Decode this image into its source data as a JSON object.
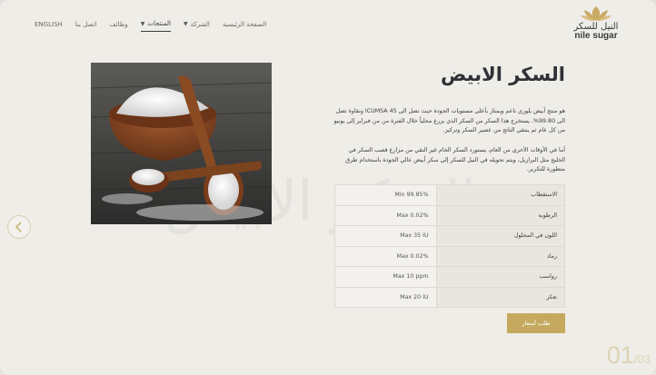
{
  "header": {
    "logo": {
      "arabic": "النيل للسكر",
      "english": "nile sugar"
    },
    "nav": [
      {
        "label": "ENGLISH"
      },
      {
        "label": "اتصل بنا"
      },
      {
        "label": "وظائف"
      },
      {
        "label": "المنتجات"
      },
      {
        "label": "الشركة"
      },
      {
        "label": "الصفحة الرئيسية"
      }
    ]
  },
  "watermark": "السكر الابيض",
  "product": {
    "title": "السكر الابيض",
    "paragraph_1": "هو منتج أبيض بلوري ناعم ويمتاز بأعلى مستويات الجودة حيث تصل الى ICUMSA 45 ونقاوة تصل الى 99.80%. يستخرج هذا السكر من السكر الذي يزرع محلياً خلال الفترة من من فبراير إلى يونيو من كل عام ثم ينتقي الناتج من عصير السكر وتركيز.",
    "paragraph_2": "أما في الأوقات الأخرى من العام، يستورد السكر الخام غير النقي من مزارع قصب السكر في الخليج مثل البرازيل، ويتم تحويله في النيل للسكر إلى سكر أبيض عالي الجودة باستخدام طرق متطورة للتكرير.",
    "specs": [
      {
        "label": "الاستقطاب",
        "value": "Min 99.85%"
      },
      {
        "label": "الرطوبة",
        "value": "Max 0.02%"
      },
      {
        "label": "اللون في المحلول",
        "value": "Max 35 IU"
      },
      {
        "label": "رماد",
        "value": "Max 0.02%"
      },
      {
        "label": "رواسب",
        "value": "Max 10 ppm"
      },
      {
        "label": "تعكر",
        "value": "Max 20 IU"
      }
    ],
    "quote_button": "طلب أسعار"
  },
  "pager": {
    "current": "01",
    "total": "/03"
  },
  "colors": {
    "accent": "#c4a95e",
    "background": "#efede8"
  }
}
